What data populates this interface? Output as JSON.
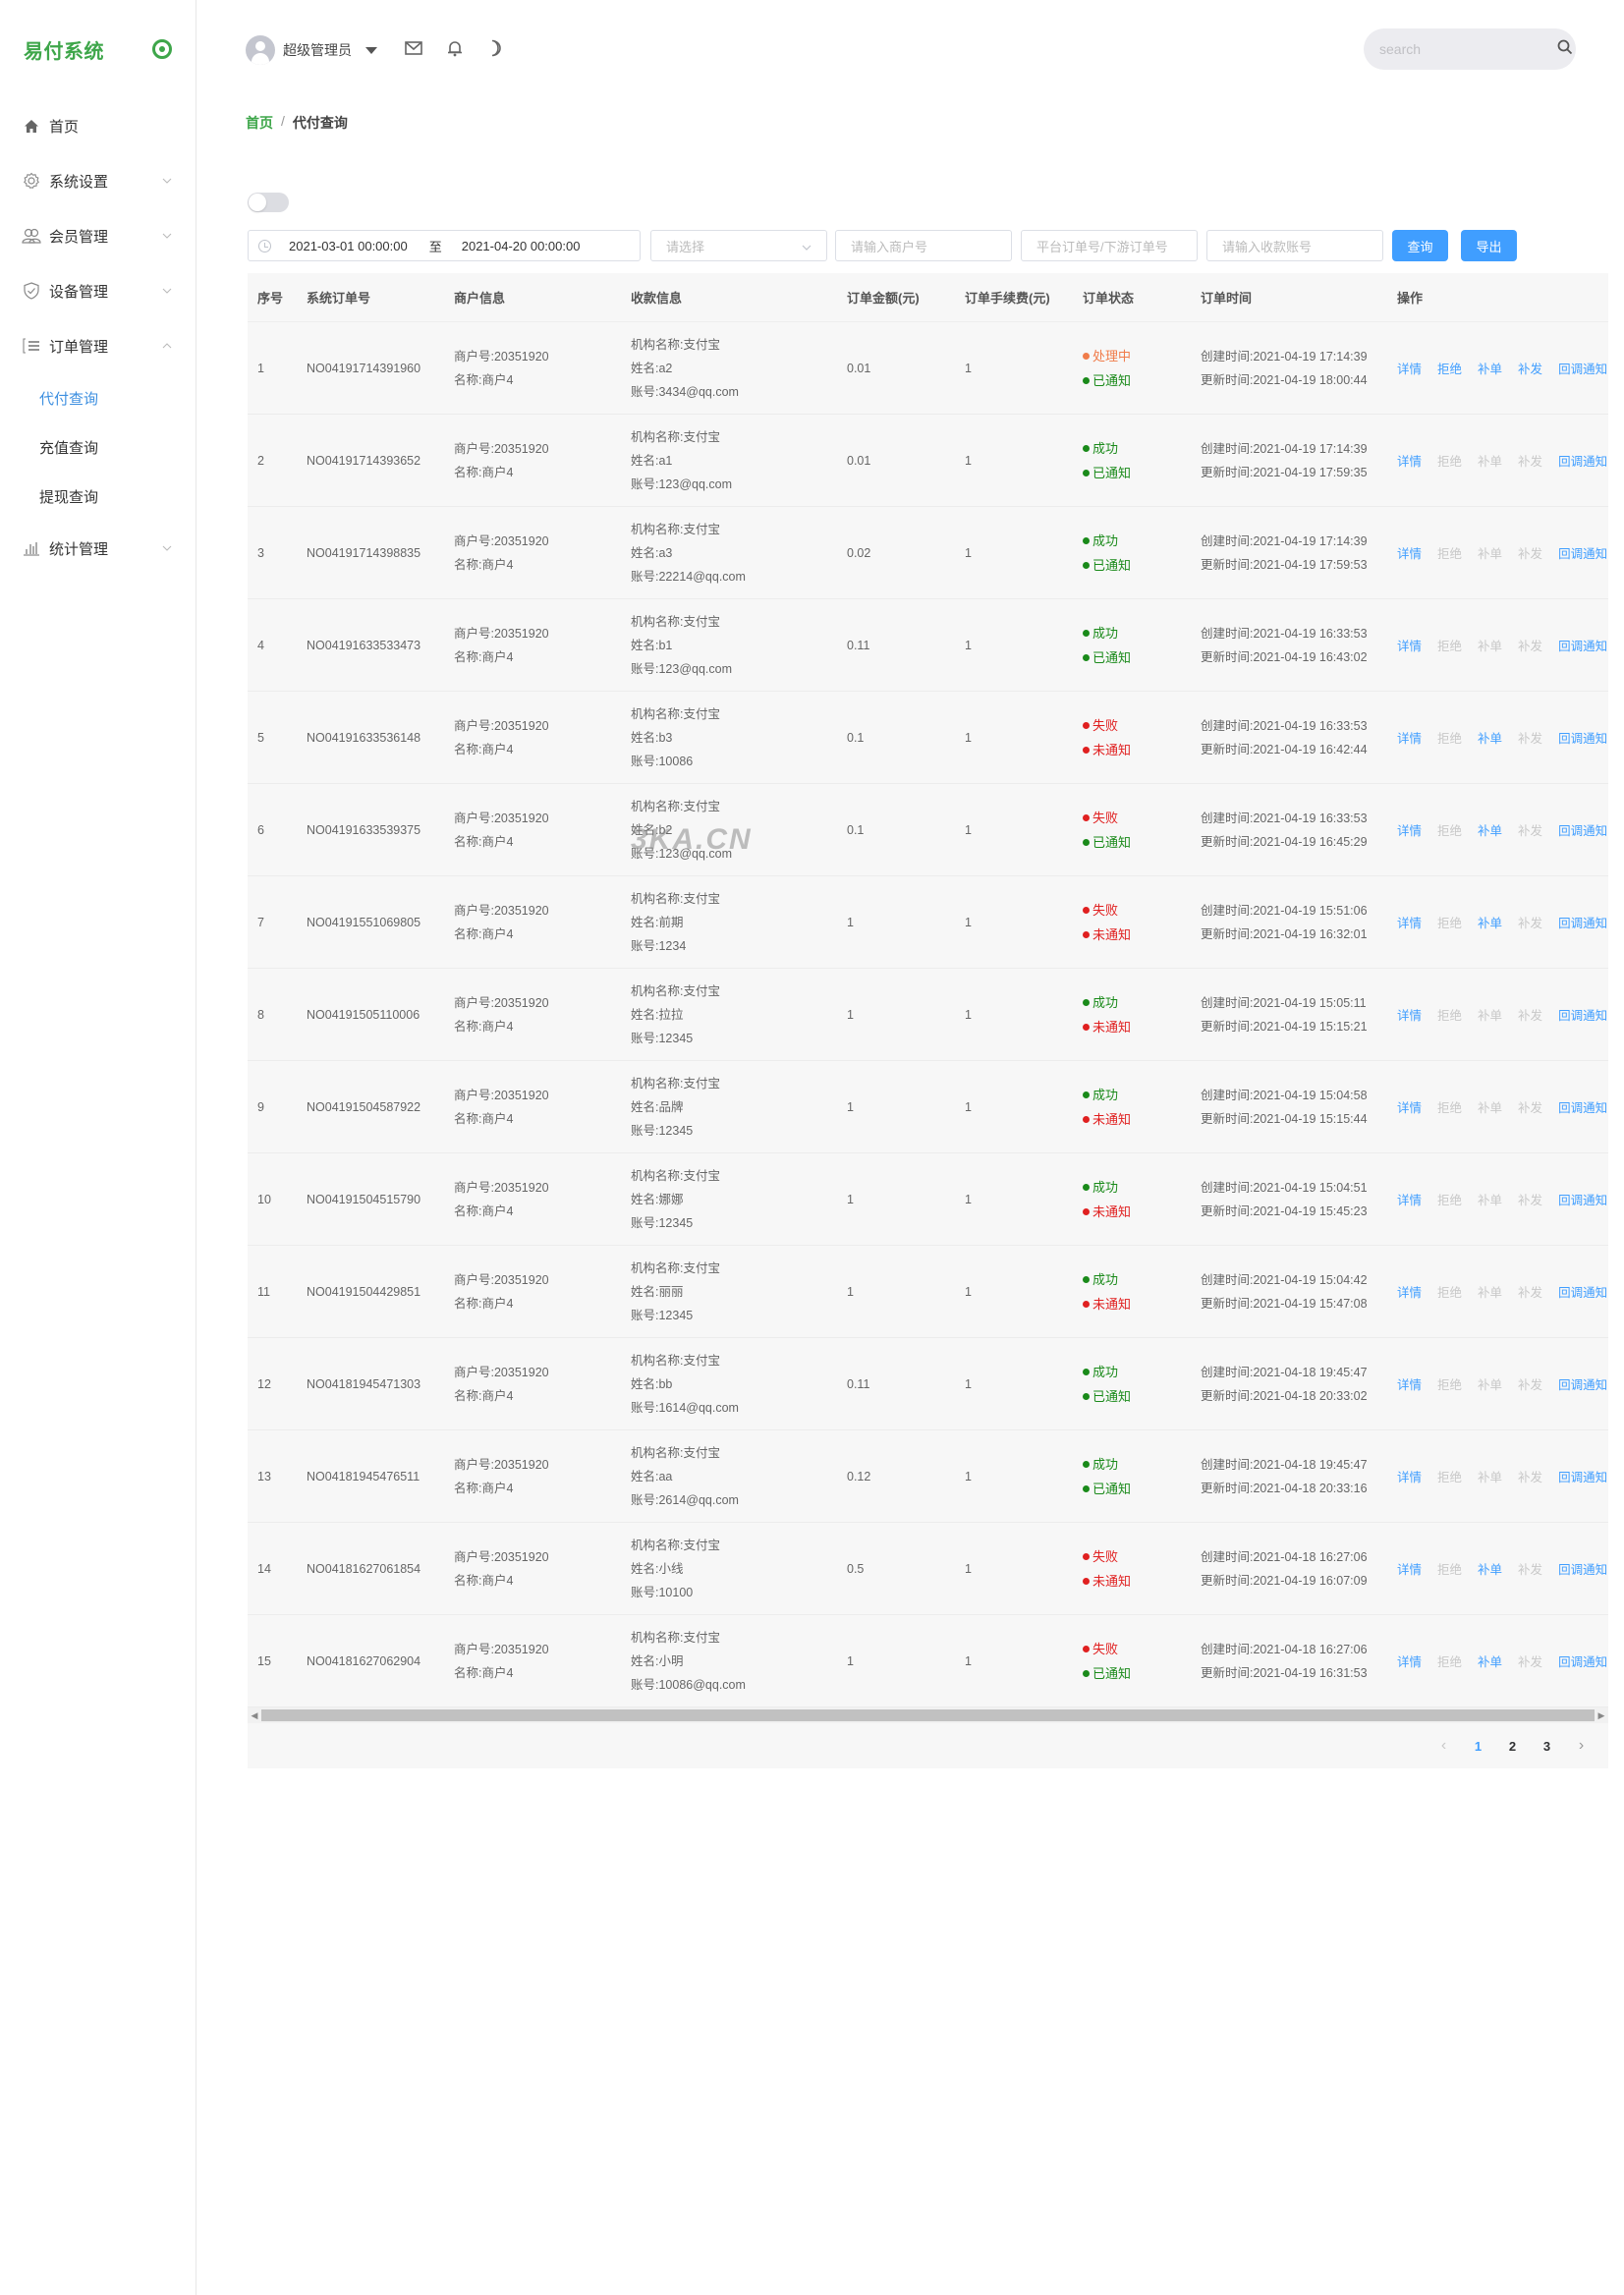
{
  "app": {
    "title": "易付系统"
  },
  "header": {
    "username": "超级管理员",
    "search_placeholder": "search"
  },
  "sidebar": {
    "items": [
      {
        "label": "首页",
        "icon": "home-icon",
        "expandable": false
      },
      {
        "label": "系统设置",
        "icon": "gear-icon",
        "expandable": true,
        "expanded": false
      },
      {
        "label": "会员管理",
        "icon": "users-icon",
        "expandable": true,
        "expanded": false
      },
      {
        "label": "设备管理",
        "icon": "shield-check-icon",
        "expandable": true,
        "expanded": false
      },
      {
        "label": "订单管理",
        "icon": "list-icon",
        "expandable": true,
        "expanded": true,
        "children": [
          {
            "label": "代付查询",
            "active": true
          },
          {
            "label": "充值查询",
            "active": false
          },
          {
            "label": "提现查询",
            "active": false
          }
        ]
      },
      {
        "label": "统计管理",
        "icon": "bar-chart-icon",
        "expandable": true,
        "expanded": false
      }
    ]
  },
  "breadcrumb": {
    "home": "首页",
    "separator": "/",
    "current": "代付查询"
  },
  "filters": {
    "date_start": "2021-03-01 00:00:00",
    "date_sep": "至",
    "date_end": "2021-04-20 00:00:00",
    "select_placeholder": "请选择",
    "merchant_placeholder": "请输入商户号",
    "order_placeholder": "平台订单号/下游订单号",
    "account_placeholder": "请输入收款账号",
    "query_label": "查询",
    "export_label": "导出"
  },
  "colors": {
    "brand": "#3ea64a",
    "link": "#409eff",
    "processing": "#f07c4a",
    "success": "#1a8a1a",
    "fail": "#e02020"
  },
  "table": {
    "headers": [
      "序号",
      "系统订单号",
      "商户信息",
      "收款信息",
      "订单金额(元)",
      "订单手续费(元)",
      "订单状态",
      "订单时间",
      "操作"
    ],
    "labels": {
      "merchant_no": "商户号:",
      "merchant_name": "名称:",
      "org": "机构名称:",
      "name": "姓名:",
      "account": "账号:",
      "created": "创建时间:",
      "updated": "更新时间:"
    },
    "actions": [
      "详情",
      "拒绝",
      "补单",
      "补发",
      "回调通知"
    ],
    "rows": [
      {
        "idx": "1",
        "order_no": "NO04191714391960",
        "merchant_no": "20351920",
        "merchant_name": "商户4",
        "org": "支付宝",
        "name": "a2",
        "account": "3434@qq.com",
        "amount": "0.01",
        "fee": "1",
        "status": "处理中",
        "status_type": "processing",
        "notify": "已通知",
        "notify_type": "success",
        "created": "2021-04-19 17:14:39",
        "updated": "2021-04-19 18:00:44",
        "enabled": [
          true,
          true,
          true,
          true,
          true
        ]
      },
      {
        "idx": "2",
        "order_no": "NO04191714393652",
        "merchant_no": "20351920",
        "merchant_name": "商户4",
        "org": "支付宝",
        "name": "a1",
        "account": "123@qq.com",
        "amount": "0.01",
        "fee": "1",
        "status": "成功",
        "status_type": "success",
        "notify": "已通知",
        "notify_type": "success",
        "created": "2021-04-19 17:14:39",
        "updated": "2021-04-19 17:59:35",
        "enabled": [
          true,
          false,
          false,
          false,
          true
        ]
      },
      {
        "idx": "3",
        "order_no": "NO04191714398835",
        "merchant_no": "20351920",
        "merchant_name": "商户4",
        "org": "支付宝",
        "name": "a3",
        "account": "22214@qq.com",
        "amount": "0.02",
        "fee": "1",
        "status": "成功",
        "status_type": "success",
        "notify": "已通知",
        "notify_type": "success",
        "created": "2021-04-19 17:14:39",
        "updated": "2021-04-19 17:59:53",
        "enabled": [
          true,
          false,
          false,
          false,
          true
        ]
      },
      {
        "idx": "4",
        "order_no": "NO04191633533473",
        "merchant_no": "20351920",
        "merchant_name": "商户4",
        "org": "支付宝",
        "name": "b1",
        "account": "123@qq.com",
        "amount": "0.11",
        "fee": "1",
        "status": "成功",
        "status_type": "success",
        "notify": "已通知",
        "notify_type": "success",
        "created": "2021-04-19 16:33:53",
        "updated": "2021-04-19 16:43:02",
        "enabled": [
          true,
          false,
          false,
          false,
          true
        ]
      },
      {
        "idx": "5",
        "order_no": "NO04191633536148",
        "merchant_no": "20351920",
        "merchant_name": "商户4",
        "org": "支付宝",
        "name": "b3",
        "account": "10086",
        "amount": "0.1",
        "fee": "1",
        "status": "失败",
        "status_type": "fail",
        "notify": "未通知",
        "notify_type": "fail",
        "created": "2021-04-19 16:33:53",
        "updated": "2021-04-19 16:42:44",
        "enabled": [
          true,
          false,
          true,
          false,
          true
        ]
      },
      {
        "idx": "6",
        "order_no": "NO04191633539375",
        "merchant_no": "20351920",
        "merchant_name": "商户4",
        "org": "支付宝",
        "name": "b2",
        "account": "123@qq.com",
        "amount": "0.1",
        "fee": "1",
        "status": "失败",
        "status_type": "fail",
        "notify": "已通知",
        "notify_type": "success",
        "created": "2021-04-19 16:33:53",
        "updated": "2021-04-19 16:45:29",
        "enabled": [
          true,
          false,
          true,
          false,
          true
        ]
      },
      {
        "idx": "7",
        "order_no": "NO04191551069805",
        "merchant_no": "20351920",
        "merchant_name": "商户4",
        "org": "支付宝",
        "name": "前期",
        "account": "1234",
        "amount": "1",
        "fee": "1",
        "status": "失败",
        "status_type": "fail",
        "notify": "未通知",
        "notify_type": "fail",
        "created": "2021-04-19 15:51:06",
        "updated": "2021-04-19 16:32:01",
        "enabled": [
          true,
          false,
          true,
          false,
          true
        ]
      },
      {
        "idx": "8",
        "order_no": "NO04191505110006",
        "merchant_no": "20351920",
        "merchant_name": "商户4",
        "org": "支付宝",
        "name": "拉拉",
        "account": "12345",
        "amount": "1",
        "fee": "1",
        "status": "成功",
        "status_type": "success",
        "notify": "未通知",
        "notify_type": "fail",
        "created": "2021-04-19 15:05:11",
        "updated": "2021-04-19 15:15:21",
        "enabled": [
          true,
          false,
          false,
          false,
          true
        ]
      },
      {
        "idx": "9",
        "order_no": "NO04191504587922",
        "merchant_no": "20351920",
        "merchant_name": "商户4",
        "org": "支付宝",
        "name": "品牌",
        "account": "12345",
        "amount": "1",
        "fee": "1",
        "status": "成功",
        "status_type": "success",
        "notify": "未通知",
        "notify_type": "fail",
        "created": "2021-04-19 15:04:58",
        "updated": "2021-04-19 15:15:44",
        "enabled": [
          true,
          false,
          false,
          false,
          true
        ]
      },
      {
        "idx": "10",
        "order_no": "NO04191504515790",
        "merchant_no": "20351920",
        "merchant_name": "商户4",
        "org": "支付宝",
        "name": "娜娜",
        "account": "12345",
        "amount": "1",
        "fee": "1",
        "status": "成功",
        "status_type": "success",
        "notify": "未通知",
        "notify_type": "fail",
        "created": "2021-04-19 15:04:51",
        "updated": "2021-04-19 15:45:23",
        "enabled": [
          true,
          false,
          false,
          false,
          true
        ]
      },
      {
        "idx": "11",
        "order_no": "NO04191504429851",
        "merchant_no": "20351920",
        "merchant_name": "商户4",
        "org": "支付宝",
        "name": "丽丽",
        "account": "12345",
        "amount": "1",
        "fee": "1",
        "status": "成功",
        "status_type": "success",
        "notify": "未通知",
        "notify_type": "fail",
        "created": "2021-04-19 15:04:42",
        "updated": "2021-04-19 15:47:08",
        "enabled": [
          true,
          false,
          false,
          false,
          true
        ]
      },
      {
        "idx": "12",
        "order_no": "NO04181945471303",
        "merchant_no": "20351920",
        "merchant_name": "商户4",
        "org": "支付宝",
        "name": "bb",
        "account": "1614@qq.com",
        "amount": "0.11",
        "fee": "1",
        "status": "成功",
        "status_type": "success",
        "notify": "已通知",
        "notify_type": "success",
        "created": "2021-04-18 19:45:47",
        "updated": "2021-04-18 20:33:02",
        "enabled": [
          true,
          false,
          false,
          false,
          true
        ]
      },
      {
        "idx": "13",
        "order_no": "NO04181945476511",
        "merchant_no": "20351920",
        "merchant_name": "商户4",
        "org": "支付宝",
        "name": "aa",
        "account": "2614@qq.com",
        "amount": "0.12",
        "fee": "1",
        "status": "成功",
        "status_type": "success",
        "notify": "已通知",
        "notify_type": "success",
        "created": "2021-04-18 19:45:47",
        "updated": "2021-04-18 20:33:16",
        "enabled": [
          true,
          false,
          false,
          false,
          true
        ]
      },
      {
        "idx": "14",
        "order_no": "NO04181627061854",
        "merchant_no": "20351920",
        "merchant_name": "商户4",
        "org": "支付宝",
        "name": "小线",
        "account": "10100",
        "amount": "0.5",
        "fee": "1",
        "status": "失败",
        "status_type": "fail",
        "notify": "未通知",
        "notify_type": "fail",
        "created": "2021-04-18 16:27:06",
        "updated": "2021-04-19 16:07:09",
        "enabled": [
          true,
          false,
          true,
          false,
          true
        ]
      },
      {
        "idx": "15",
        "order_no": "NO04181627062904",
        "merchant_no": "20351920",
        "merchant_name": "商户4",
        "org": "支付宝",
        "name": "小明",
        "account": "10086@qq.com",
        "amount": "1",
        "fee": "1",
        "status": "失败",
        "status_type": "fail",
        "notify": "已通知",
        "notify_type": "success",
        "created": "2021-04-18 16:27:06",
        "updated": "2021-04-19 16:31:53",
        "enabled": [
          true,
          false,
          true,
          false,
          true
        ]
      }
    ]
  },
  "pagination": {
    "pages": [
      "1",
      "2",
      "3"
    ],
    "current": "1",
    "prev": "‹",
    "next": "›"
  },
  "watermark": "3KA.CN"
}
